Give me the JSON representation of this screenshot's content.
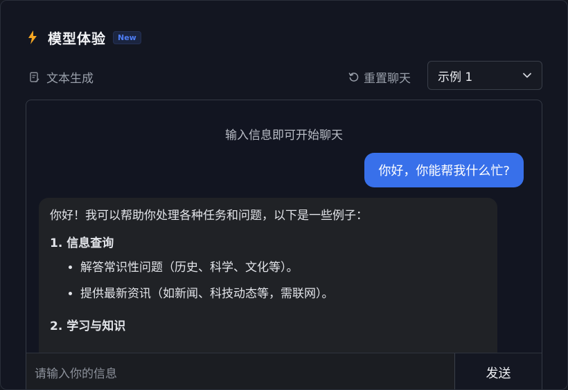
{
  "header": {
    "icon": "lightning-bolt-icon",
    "title": "模型体验",
    "badge": "New"
  },
  "toolbar": {
    "mode_icon": "text-edit-icon",
    "mode_label": "文本生成",
    "reset_icon": "reset-icon",
    "reset_label": "重置聊天",
    "example_select": {
      "selected": "示例 1",
      "chevron": "chevron-down-icon"
    }
  },
  "chat": {
    "hint": "输入信息即可开始聊天",
    "user_message": "你好，你能帮我什么忙?",
    "bot_message": {
      "intro": "你好！我可以帮助你处理各种任务和问题，以下是一些例子：",
      "sections": [
        {
          "heading": "1. 信息查询",
          "items": [
            "解答常识性问题（历史、科学、文化等）。",
            "提供最新资讯（如新闻、科技动态等，需联网）。"
          ]
        },
        {
          "heading": "2. 学习与知识",
          "items": []
        }
      ]
    },
    "input": {
      "placeholder": "请输入你的信息",
      "value": ""
    },
    "send_label": "发送"
  },
  "colors": {
    "background": "#131621",
    "accent": "#3870ea",
    "bolt": "#f5a623",
    "badge": "#4e7df5"
  }
}
